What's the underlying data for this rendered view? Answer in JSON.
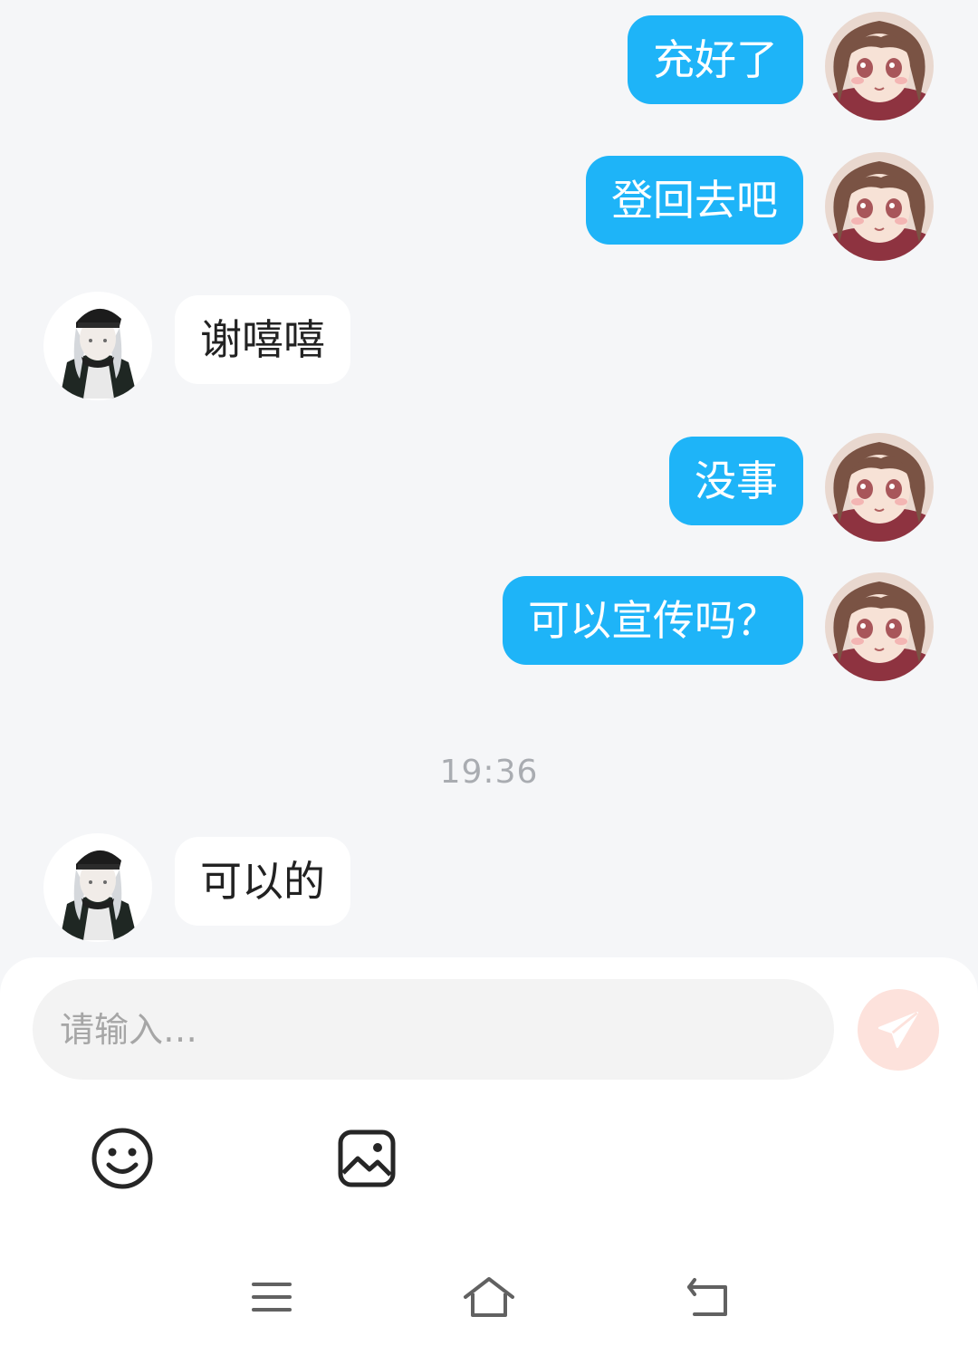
{
  "messages": [
    {
      "side": "out",
      "text": "充好了"
    },
    {
      "side": "out",
      "text": "登回去吧"
    },
    {
      "side": "in",
      "text": "谢嘻嘻"
    },
    {
      "side": "out",
      "text": "没事"
    },
    {
      "side": "out",
      "text": "可以宣传吗？"
    },
    {
      "side": "in",
      "text": "可以的"
    }
  ],
  "timestamp": "19:36",
  "composer": {
    "placeholder": "请输入…",
    "send_icon": "paper-plane-icon",
    "tools": [
      "smiley-icon",
      "image-icon"
    ]
  },
  "navbar": {
    "icons": [
      "menu-icon",
      "home-icon",
      "back-icon"
    ]
  },
  "colors": {
    "outgoing_bubble": "#1eb4f8",
    "incoming_bubble": "#ffffff",
    "background": "#f5f6f8",
    "send_button": "#fde2dc"
  }
}
